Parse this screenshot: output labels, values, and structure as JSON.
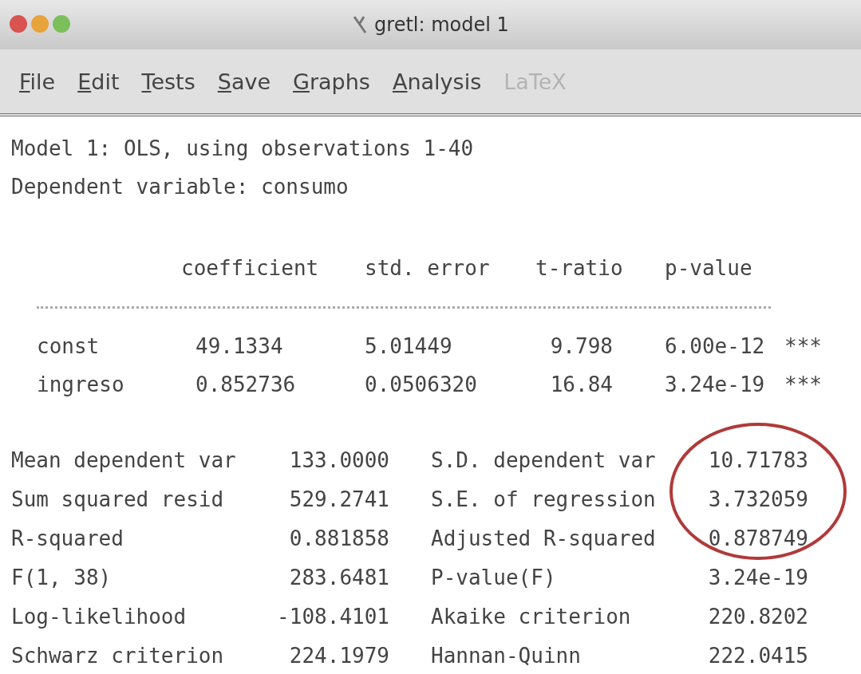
{
  "window": {
    "title": "gretl: model 1"
  },
  "menu": [
    {
      "label": "File",
      "underline_first": true,
      "disabled": false
    },
    {
      "label": "Edit",
      "underline_first": true,
      "disabled": false
    },
    {
      "label": "Tests",
      "underline_first": true,
      "disabled": false
    },
    {
      "label": "Save",
      "underline_first": true,
      "disabled": false
    },
    {
      "label": "Graphs",
      "underline_first": true,
      "disabled": false
    },
    {
      "label": "Analysis",
      "underline_first": true,
      "disabled": false
    },
    {
      "label": "LaTeX",
      "underline_first": false,
      "disabled": true
    }
  ],
  "output": {
    "heading": [
      "Model 1: OLS, using observations 1-40",
      "Dependent variable: consumo"
    ],
    "table": {
      "columns": [
        "coefficient",
        "std. error",
        "t-ratio",
        "p-value"
      ],
      "rows": [
        {
          "name": "const",
          "coefficient": "49.1334",
          "std_error": "5.01449",
          "t_ratio": "9.798",
          "p_value": "6.00e-12",
          "stars": "***"
        },
        {
          "name": "ingreso",
          "coefficient": "0.852736",
          "std_error": "0.0506320",
          "t_ratio": "16.84",
          "p_value": "3.24e-19",
          "stars": "***"
        }
      ]
    },
    "stats": [
      {
        "label": "Mean dependent var",
        "value": "133.0000",
        "label_2": "S.D. dependent var",
        "value_2": "10.71783"
      },
      {
        "label": "Sum squared resid",
        "value": "529.2741",
        "label_2": "S.E. of regression",
        "value_2": "3.732059"
      },
      {
        "label": "R-squared",
        "value": "0.881858",
        "label_2": "Adjusted R-squared",
        "value_2": "0.878749"
      },
      {
        "label": "F(1, 38)",
        "value": "283.6481",
        "label_2": "P-value(F)",
        "value_2": "3.24e-19"
      },
      {
        "label": "Log-likelihood",
        "value": "-108.4101",
        "label_2": "Akaike criterion",
        "value_2": "220.8202"
      },
      {
        "label": "Schwarz criterion",
        "value": "224.1979",
        "label_2": "Hannan-Quinn",
        "value_2": "222.0415"
      }
    ]
  }
}
